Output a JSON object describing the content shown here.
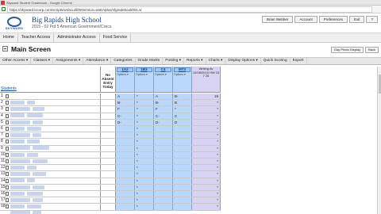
{
  "window": {
    "title": "Skyward Student Gradebook - Google Chrome"
  },
  "browser": {
    "url": "https://skyward.iscorp.com/scripts/wsisa.dll/WService=wsEAplus/sfgradebook001.w"
  },
  "header": {
    "logo_text": "SKYWARD",
    "school_name": "Big Rapids High School",
    "course_line": "2015 - 02 Prd 5 American Government/Civics",
    "user_buttons": [
      "Brian Webber",
      "Account",
      "Preferences",
      "Exit",
      "?"
    ]
  },
  "nav_tabs": [
    "Home",
    "Teacher Access",
    "Administrator Access",
    "Food Service"
  ],
  "main": {
    "title": "Main Screen",
    "right_buttons": [
      "Day Photo Display",
      "Back"
    ]
  },
  "menu": [
    "Other Access ▾",
    "Classes ▾",
    "Assignments ▾",
    "Attendance ▾",
    "Categories",
    "Grade Marks",
    "Posting ▾",
    "Reports ▾",
    "Charts ▾",
    "Display Options ▾",
    "Quick Scoring",
    "Export"
  ],
  "grid": {
    "students_label": "Students",
    "noabs_label": "No Absent Entry Today",
    "assignments": [
      {
        "name": "1A2",
        "opt": "Options ▾"
      },
      {
        "name": "1B3",
        "opt": "Options ▾"
      },
      {
        "name": "C4",
        "opt": "Options ▾"
      },
      {
        "name": "MT3",
        "opt": "Options ▾"
      }
    ],
    "writing_head": "Writing Av 12/08/2015 HW 15 7 26",
    "rows": [
      {
        "num": "1",
        "grades": [
          "A",
          "*",
          "A",
          "B-"
        ],
        "writing": "19"
      },
      {
        "num": "2",
        "grades": [
          "B-",
          "*",
          "B-",
          "B"
        ],
        "writing": "*"
      },
      {
        "num": "3",
        "grades": [
          "F",
          "*",
          "F",
          "*"
        ],
        "writing": "*"
      },
      {
        "num": "4",
        "grades": [
          "C-",
          "*",
          "C-",
          "C"
        ],
        "writing": "*"
      },
      {
        "num": "5",
        "grades": [
          "D-",
          "*",
          "D-",
          "D"
        ],
        "writing": "*"
      },
      {
        "num": "6",
        "grades": [
          "",
          "*",
          "",
          ""
        ],
        "writing": "*"
      },
      {
        "num": "7",
        "grades": [
          "",
          "*",
          "",
          ""
        ],
        "writing": "*"
      },
      {
        "num": "8",
        "grades": [
          "",
          "*",
          "",
          ""
        ],
        "writing": "*"
      },
      {
        "num": "9",
        "grades": [
          "",
          "*",
          "",
          ""
        ],
        "writing": "*"
      },
      {
        "num": "10",
        "grades": [
          "",
          "*",
          "",
          ""
        ],
        "writing": "*"
      },
      {
        "num": "11",
        "grades": [
          "",
          "*",
          "",
          ""
        ],
        "writing": "*"
      },
      {
        "num": "12",
        "grades": [
          "",
          "*",
          "",
          ""
        ],
        "writing": "*"
      },
      {
        "num": "13",
        "grades": [
          "",
          "*",
          "",
          ""
        ],
        "writing": "*"
      },
      {
        "num": "14",
        "grades": [
          "",
          "*",
          "",
          ""
        ],
        "writing": "*"
      },
      {
        "num": "15",
        "grades": [
          "",
          "*",
          "",
          ""
        ],
        "writing": "*"
      },
      {
        "num": "16",
        "grades": [
          "",
          "*",
          "",
          ""
        ],
        "writing": "*"
      },
      {
        "num": "17",
        "grades": [
          "",
          "*",
          "",
          ""
        ],
        "writing": "*"
      },
      {
        "num": "18",
        "grades": [
          "",
          "*",
          "",
          ""
        ],
        "writing": "*"
      }
    ]
  },
  "colors": {
    "grade_col": "#b9d8fb",
    "writing_col": "#d9d3f2",
    "brand": "#1a3d7c"
  }
}
